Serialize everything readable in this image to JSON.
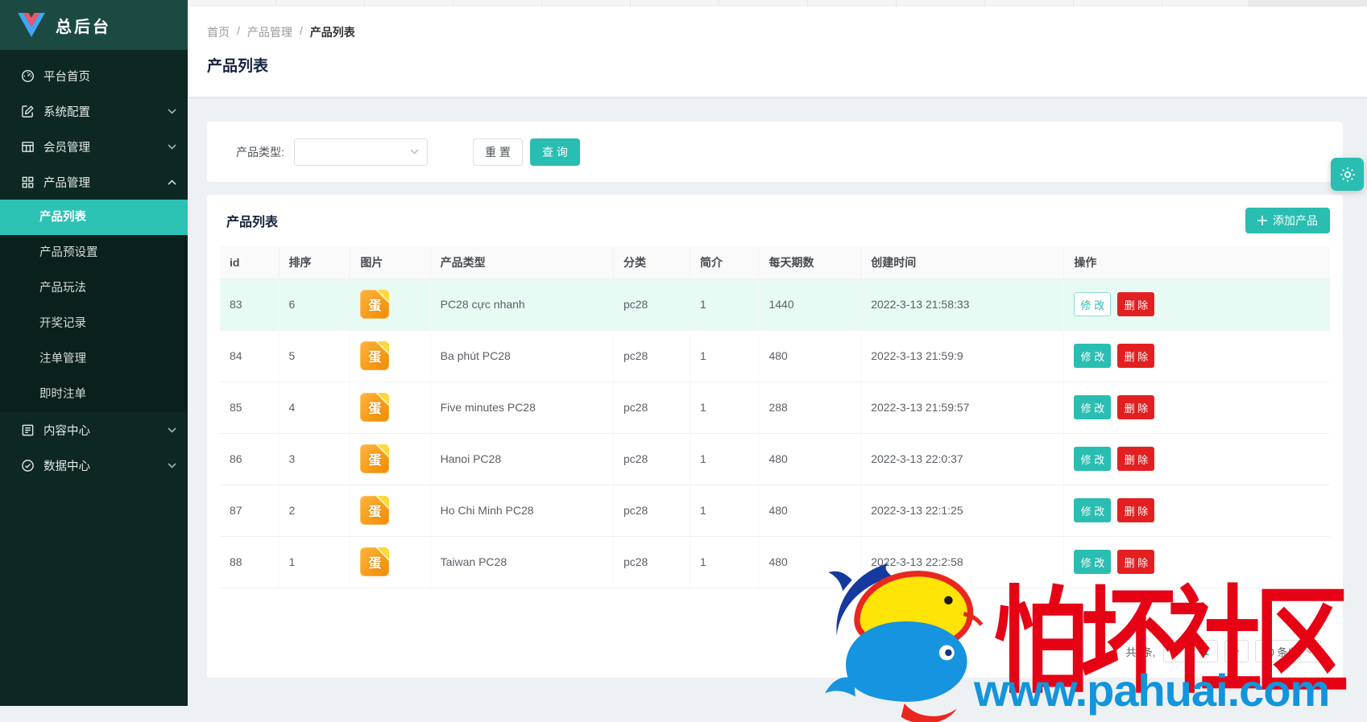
{
  "app": {
    "title": "总后台"
  },
  "colors": {
    "accent_teal": "#2abdb1",
    "danger_red": "#e32021",
    "sidebar_bg": "#0d2723",
    "sidebar_header_bg": "#1b4a42",
    "row_highlight": "#e7faf4",
    "watermark_red": "#e60114",
    "watermark_blue": "#1295dc"
  },
  "sidebar": {
    "logo_title": "总后台",
    "items": [
      {
        "name": "platform-home",
        "label": "平台首页",
        "icon": "dashboard-icon"
      },
      {
        "name": "system-config",
        "label": "系统配置",
        "icon": "edit-icon",
        "chevron": "down"
      },
      {
        "name": "member-management",
        "label": "会员管理",
        "icon": "members-icon",
        "chevron": "down"
      },
      {
        "name": "product-management",
        "label": "产品管理",
        "icon": "products-icon",
        "chevron": "up",
        "expanded": true,
        "children": [
          {
            "name": "product-list",
            "label": "产品列表",
            "active": true
          },
          {
            "name": "product-preset",
            "label": "产品预设置"
          },
          {
            "name": "product-play",
            "label": "产品玩法"
          },
          {
            "name": "draw-records",
            "label": "开奖记录"
          },
          {
            "name": "bet-management",
            "label": "注单管理"
          },
          {
            "name": "realtime-bets",
            "label": "即时注单"
          }
        ]
      },
      {
        "name": "content-center",
        "label": "内容中心",
        "icon": "content-icon",
        "chevron": "down"
      },
      {
        "name": "data-center",
        "label": "数据中心",
        "icon": "data-icon",
        "chevron": "down"
      }
    ]
  },
  "breadcrumb": {
    "items": [
      "首页",
      "产品管理",
      "产品列表"
    ],
    "separator": "/"
  },
  "page": {
    "title": "产品列表"
  },
  "filter": {
    "type_label": "产品类型:",
    "type_value": "",
    "reset_label": "重 置",
    "search_label": "查 询"
  },
  "table_card": {
    "title": "产品列表",
    "add_button_label": "添加产品"
  },
  "table": {
    "columns": [
      "id",
      "排序",
      "图片",
      "产品类型",
      "分类",
      "简介",
      "每天期数",
      "创建时间",
      "操作"
    ],
    "image_icon_char": "蛋",
    "edit_label": "修 改",
    "delete_label": "删 除",
    "rows": [
      {
        "id": "83",
        "sort": "6",
        "type": "PC28 cực nhanh",
        "category": "pc28",
        "intro": "1",
        "daily": "1440",
        "created": "2022-3-13 21:58:33",
        "highlight": true,
        "edit_style": "plain"
      },
      {
        "id": "84",
        "sort": "5",
        "type": "Ba phút PC28",
        "category": "pc28",
        "intro": "1",
        "daily": "480",
        "created": "2022-3-13 21:59:9"
      },
      {
        "id": "85",
        "sort": "4",
        "type": "Five minutes PC28",
        "category": "pc28",
        "intro": "1",
        "daily": "288",
        "created": "2022-3-13 21:59:57"
      },
      {
        "id": "86",
        "sort": "3",
        "type": "Hanoi PC28",
        "category": "pc28",
        "intro": "1",
        "daily": "480",
        "created": "2022-3-13 22:0:37"
      },
      {
        "id": "87",
        "sort": "2",
        "type": "Ho Chi Minh PC28",
        "category": "pc28",
        "intro": "1",
        "daily": "480",
        "created": "2022-3-13 22:1:25"
      },
      {
        "id": "88",
        "sort": "1",
        "type": "Taiwan PC28",
        "category": "pc28",
        "intro": "1",
        "daily": "480",
        "created": "2022-3-13 22:2:58"
      }
    ]
  },
  "pagination": {
    "total_text": "共6条,",
    "current_page": "1",
    "page_size": "10 条/页"
  },
  "watermark": {
    "text": "怕坏社区",
    "url": "www.pahuai.com"
  }
}
